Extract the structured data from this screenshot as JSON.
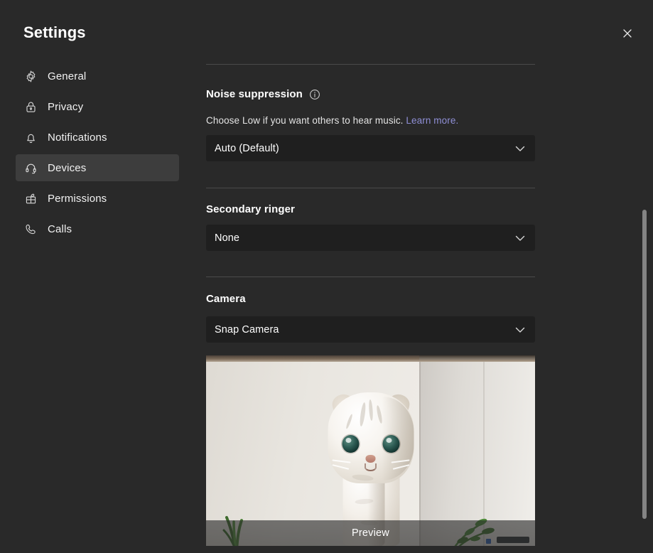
{
  "window": {
    "title": "Settings",
    "close_icon": "close-icon",
    "background_color": "#292929"
  },
  "sidebar": {
    "items": [
      {
        "label": "General",
        "icon": "gear-icon",
        "selected": false
      },
      {
        "label": "Privacy",
        "icon": "lock-icon",
        "selected": false
      },
      {
        "label": "Notifications",
        "icon": "bell-icon",
        "selected": false
      },
      {
        "label": "Devices",
        "icon": "headset-icon",
        "selected": true
      },
      {
        "label": "Permissions",
        "icon": "permissions-icon",
        "selected": false
      },
      {
        "label": "Calls",
        "icon": "phone-icon",
        "selected": false
      }
    ]
  },
  "content": {
    "noise_suppression": {
      "title": "Noise suppression",
      "info_icon": "info-icon",
      "help_text": "Choose Low if you want others to hear music.",
      "learn_more_label": "Learn more.",
      "learn_more_color": "#8f8fd6",
      "dropdown_value": "Auto (Default)",
      "dropdown_icon": "chevron-down-icon"
    },
    "secondary_ringer": {
      "title": "Secondary ringer",
      "dropdown_value": "None",
      "dropdown_icon": "chevron-down-icon"
    },
    "camera": {
      "title": "Camera",
      "dropdown_value": "Snap Camera",
      "dropdown_icon": "chevron-down-icon",
      "preview_label": "Preview"
    }
  },
  "scrollbar": {
    "thumb_color": "#848484"
  }
}
